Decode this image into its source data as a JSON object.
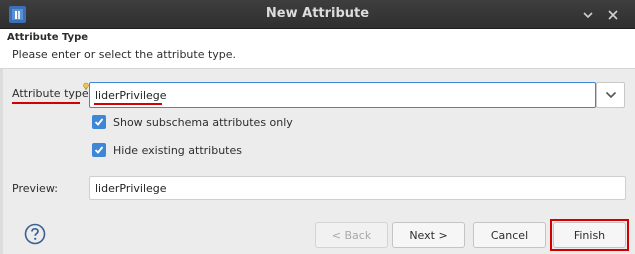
{
  "window": {
    "title": "New Attribute",
    "app_icon": "application-icon",
    "controls": [
      "minimize-icon",
      "close-icon"
    ]
  },
  "header": {
    "title": "Attribute Type",
    "description": "Please enter or select the attribute type."
  },
  "form": {
    "attribute_type_label": "Attribute type:",
    "attribute_type_value": "liderPrivilege",
    "show_subschema_label": "Show subschema attributes only",
    "show_subschema_checked": true,
    "hide_existing_label": "Hide existing attributes",
    "hide_existing_checked": true,
    "preview_label": "Preview:",
    "preview_value": "liderPrivilege"
  },
  "buttons": {
    "help": "help-icon",
    "back": "< Back",
    "next": "Next >",
    "cancel": "Cancel",
    "finish": "Finish"
  },
  "colors": {
    "accent": "#3d87d6",
    "annotation": "#d40000",
    "titlebar": "#353535"
  }
}
